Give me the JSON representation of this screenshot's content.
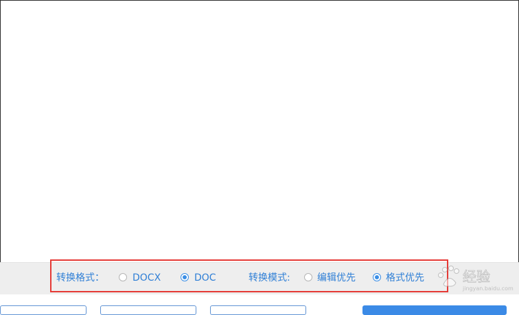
{
  "options": {
    "format_label": "转换格式：",
    "format_options": [
      {
        "label": "DOCX",
        "checked": false
      },
      {
        "label": "DOC",
        "checked": true
      }
    ],
    "mode_label": "转换模式:",
    "mode_options": [
      {
        "label": "编辑优先",
        "checked": false
      },
      {
        "label": "格式优先",
        "checked": true
      }
    ]
  },
  "watermark": {
    "text": "经验",
    "subtext": "jingyan.baidu.com"
  },
  "colors": {
    "accent": "#2f7fd6",
    "radio_checked": "#3a8ee6",
    "highlight": "#e53935",
    "bar_background": "#eeeeee",
    "primary_button": "#3b8ae6"
  }
}
